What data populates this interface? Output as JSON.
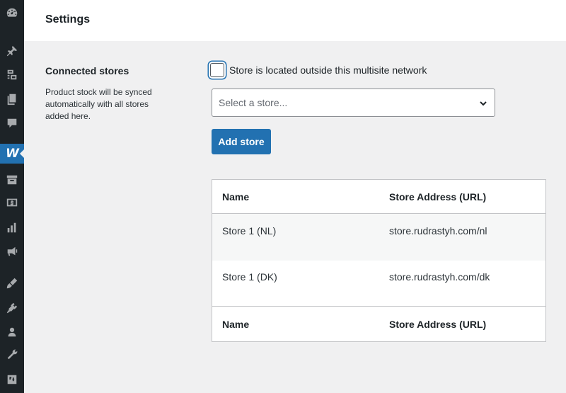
{
  "sidebar": {
    "items": [
      {
        "icon": "dashboard-icon"
      },
      {
        "icon": "pin-icon"
      },
      {
        "icon": "media-icon"
      },
      {
        "icon": "pages-icon"
      },
      {
        "icon": "comments-icon"
      },
      {
        "icon": "woocommerce-logo-icon",
        "label": "W",
        "active": true
      },
      {
        "icon": "products-icon"
      },
      {
        "icon": "payments-icon"
      },
      {
        "icon": "analytics-icon"
      },
      {
        "icon": "marketing-icon"
      },
      {
        "icon": "appearance-icon"
      },
      {
        "icon": "plugins-icon"
      },
      {
        "icon": "users-icon"
      },
      {
        "icon": "tools-icon"
      },
      {
        "icon": "settings-icon"
      }
    ]
  },
  "header": {
    "title": "Settings"
  },
  "section": {
    "title": "Connected stores",
    "description": "Product stock will be synced automatically with all stores added here."
  },
  "form": {
    "checkbox_label": "Store is located outside this multisite network",
    "checkbox_checked": false,
    "select_placeholder": "Select a store...",
    "add_button": "Add store"
  },
  "table": {
    "headers": [
      "Name",
      "Store Address (URL)"
    ],
    "rows": [
      [
        "Store 1 (NL)",
        "store.rudrastyh.com/nl"
      ],
      [
        "Store 1 (DK)",
        "store.rudrastyh.com/dk"
      ]
    ],
    "footers": [
      "Name",
      "Store Address (URL)"
    ]
  },
  "colors": {
    "sidebar_bg": "#1d2327",
    "accent": "#2271b1",
    "page_bg": "#f0f0f1"
  }
}
